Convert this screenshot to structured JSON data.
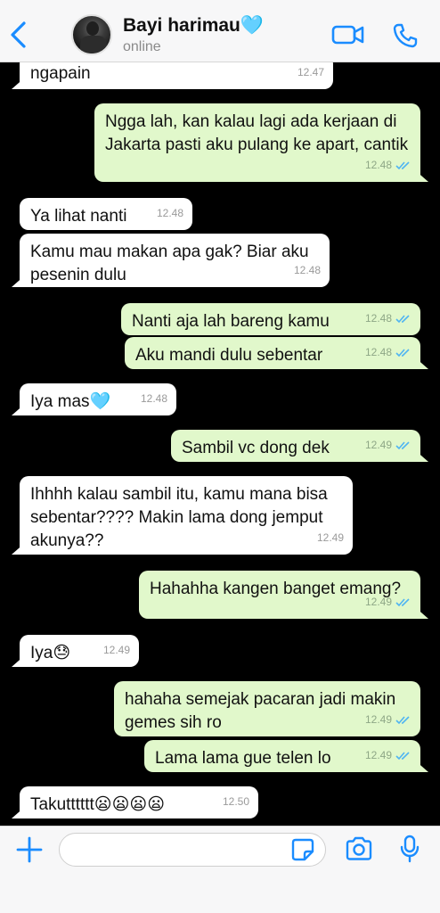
{
  "header": {
    "contact_name": "Bayi harimau",
    "contact_emoji": "🩵",
    "status": "online",
    "accent_color": "#1a8cff"
  },
  "messages": [
    {
      "dir": "in",
      "text": "ngapain",
      "time": "12.47",
      "read": false
    },
    {
      "dir": "out",
      "text": "Ngga lah, kan kalau lagi ada kerjaan di Jakarta pasti aku pulang ke apart, cantik",
      "time": "12.48",
      "read": true
    },
    {
      "dir": "in",
      "text": "Ya lihat nanti",
      "time": "12.48",
      "read": false
    },
    {
      "dir": "in",
      "text": "Kamu mau makan apa gak? Biar aku pesenin dulu",
      "time": "12.48",
      "read": false
    },
    {
      "dir": "out",
      "text": "Nanti aja lah bareng kamu",
      "time": "12.48",
      "read": true
    },
    {
      "dir": "out",
      "text": "Aku mandi dulu sebentar",
      "time": "12.48",
      "read": true
    },
    {
      "dir": "in",
      "text": "Iya mas🩵",
      "time": "12.48",
      "read": false
    },
    {
      "dir": "out",
      "text": "Sambil vc dong dek",
      "time": "12.49",
      "read": true
    },
    {
      "dir": "in",
      "text": "Ihhhh kalau sambil itu, kamu mana bisa sebentar???? Makin lama dong jemput akunya??",
      "time": "12.49",
      "read": false
    },
    {
      "dir": "out",
      "text": "Hahahha kangen banget emang?",
      "time": "12.49",
      "read": true
    },
    {
      "dir": "in",
      "text": "Iya😓",
      "time": "12.49",
      "read": false
    },
    {
      "dir": "out",
      "text": "hahaha semejak pacaran jadi makin gemes sih ro",
      "time": "12.49",
      "read": true
    },
    {
      "dir": "out",
      "text": "Lama lama gue telen lo",
      "time": "12.49",
      "read": true
    },
    {
      "dir": "in",
      "text": "Takutttttt😦😦😦😦",
      "time": "12.50",
      "read": false
    }
  ],
  "input": {
    "placeholder": ""
  },
  "icons": {
    "back": "chevron-left-icon",
    "video_call": "video-camera-icon",
    "voice_call": "phone-icon",
    "attach": "plus-icon",
    "sticker": "sticker-icon",
    "camera": "camera-icon",
    "microphone": "microphone-icon"
  },
  "colors": {
    "incoming_bubble": "#ffffff",
    "outgoing_bubble": "#e1f8cb",
    "read_tick": "#4fb4f2",
    "chat_background": "#000000"
  }
}
